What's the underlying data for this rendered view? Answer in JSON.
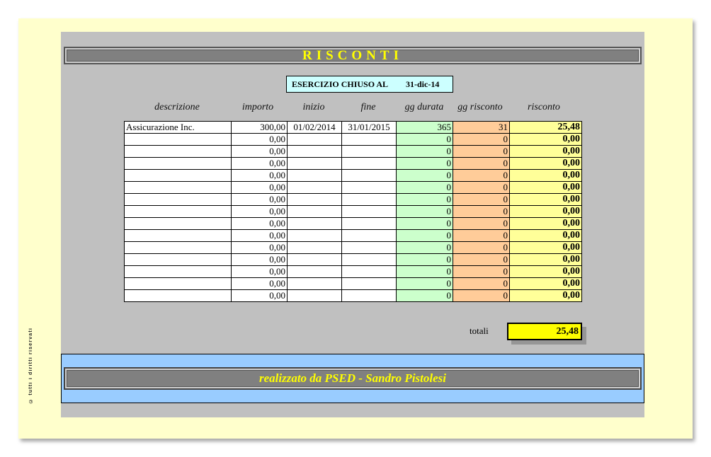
{
  "copyright": "© tutti i diritti riservati",
  "title": "RISCONTI",
  "esercizio": {
    "label": "ESERCIZIO CHIUSO AL",
    "value": "31-dic-14"
  },
  "headers": {
    "descrizione": "descrizione",
    "importo": "importo",
    "inizio": "inizio",
    "fine": "fine",
    "gg_durata": "gg durata",
    "gg_risconto": "gg risconto",
    "risconto": "risconto"
  },
  "rows": [
    {
      "descrizione": "Assicurazione Inc.",
      "importo": "300,00",
      "inizio": "01/02/2014",
      "fine": "31/01/2015",
      "gg_durata": "365",
      "gg_risconto": "31",
      "risconto": "25,48"
    },
    {
      "descrizione": "",
      "importo": "0,00",
      "inizio": "",
      "fine": "",
      "gg_durata": "0",
      "gg_risconto": "0",
      "risconto": "0,00"
    },
    {
      "descrizione": "",
      "importo": "0,00",
      "inizio": "",
      "fine": "",
      "gg_durata": "0",
      "gg_risconto": "0",
      "risconto": "0,00"
    },
    {
      "descrizione": "",
      "importo": "0,00",
      "inizio": "",
      "fine": "",
      "gg_durata": "0",
      "gg_risconto": "0",
      "risconto": "0,00"
    },
    {
      "descrizione": "",
      "importo": "0,00",
      "inizio": "",
      "fine": "",
      "gg_durata": "0",
      "gg_risconto": "0",
      "risconto": "0,00"
    },
    {
      "descrizione": "",
      "importo": "0,00",
      "inizio": "",
      "fine": "",
      "gg_durata": "0",
      "gg_risconto": "0",
      "risconto": "0,00"
    },
    {
      "descrizione": "",
      "importo": "0,00",
      "inizio": "",
      "fine": "",
      "gg_durata": "0",
      "gg_risconto": "0",
      "risconto": "0,00"
    },
    {
      "descrizione": "",
      "importo": "0,00",
      "inizio": "",
      "fine": "",
      "gg_durata": "0",
      "gg_risconto": "0",
      "risconto": "0,00"
    },
    {
      "descrizione": "",
      "importo": "0,00",
      "inizio": "",
      "fine": "",
      "gg_durata": "0",
      "gg_risconto": "0",
      "risconto": "0,00"
    },
    {
      "descrizione": "",
      "importo": "0,00",
      "inizio": "",
      "fine": "",
      "gg_durata": "0",
      "gg_risconto": "0",
      "risconto": "0,00"
    },
    {
      "descrizione": "",
      "importo": "0,00",
      "inizio": "",
      "fine": "",
      "gg_durata": "0",
      "gg_risconto": "0",
      "risconto": "0,00"
    },
    {
      "descrizione": "",
      "importo": "0,00",
      "inizio": "",
      "fine": "",
      "gg_durata": "0",
      "gg_risconto": "0",
      "risconto": "0,00"
    },
    {
      "descrizione": "",
      "importo": "0,00",
      "inizio": "",
      "fine": "",
      "gg_durata": "0",
      "gg_risconto": "0",
      "risconto": "0,00"
    },
    {
      "descrizione": "",
      "importo": "0,00",
      "inizio": "",
      "fine": "",
      "gg_durata": "0",
      "gg_risconto": "0",
      "risconto": "0,00"
    },
    {
      "descrizione": "",
      "importo": "0,00",
      "inizio": "",
      "fine": "",
      "gg_durata": "0",
      "gg_risconto": "0",
      "risconto": "0,00"
    }
  ],
  "totali": {
    "label": "totali",
    "value": "25,48"
  },
  "footer": "realizzato da PSED - Sandro Pistolesi",
  "colors": {
    "page_bg": "#ffffcc",
    "sheet_bg": "#c0c0c0",
    "title_bar": "#808080",
    "title_text": "#ffff00",
    "durata": "#ccffcc",
    "gg_risconto": "#ffcc99",
    "risconto": "#ffff99",
    "total": "#ffff00",
    "footer_bg": "#99ccff"
  }
}
